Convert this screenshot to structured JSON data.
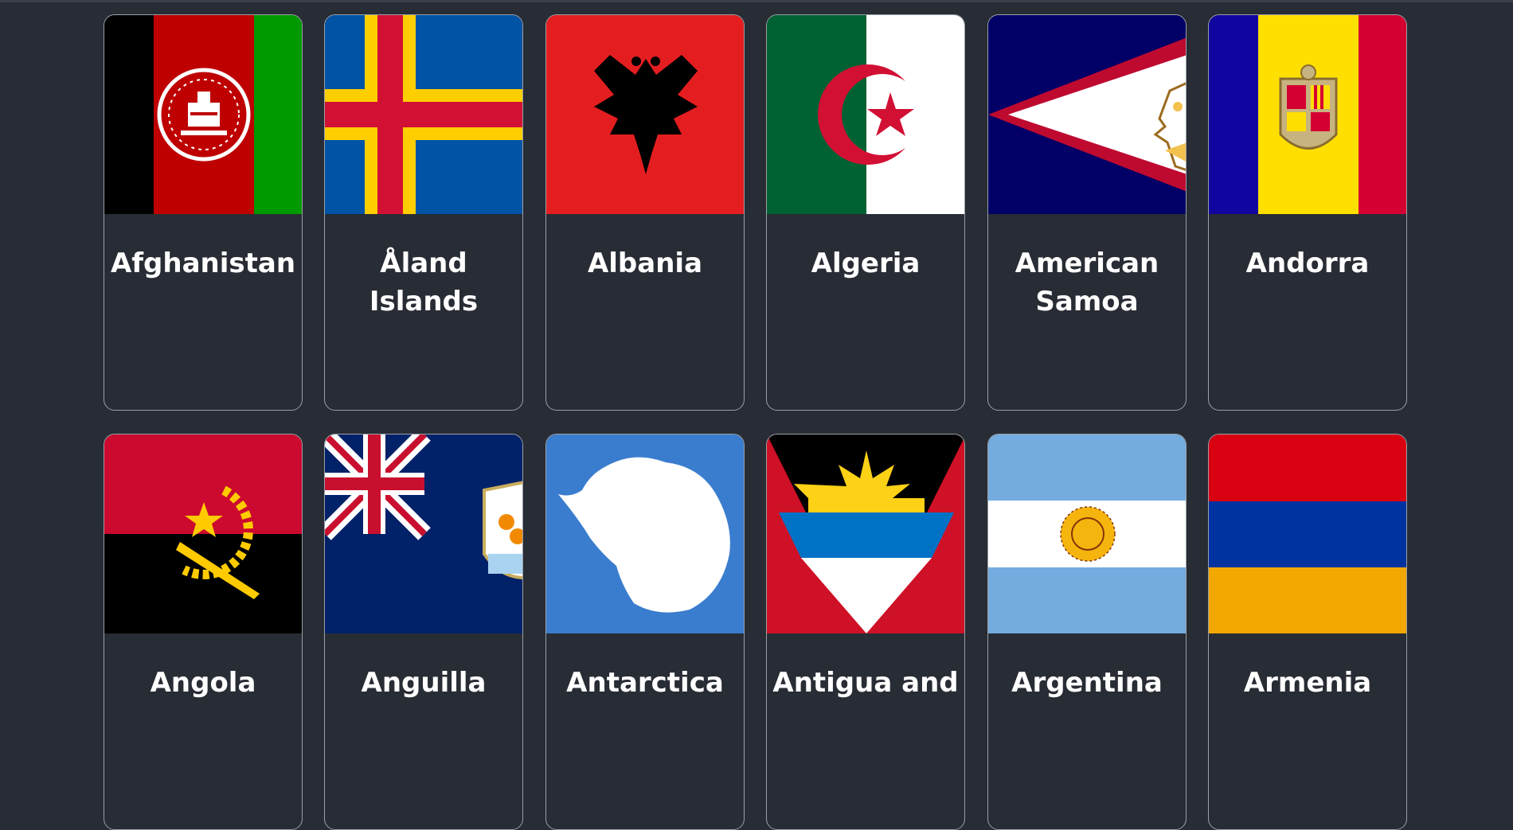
{
  "colors": {
    "background": "#282c34",
    "card_border": "#9aa0a8",
    "text": "#ffffff"
  },
  "countries": [
    {
      "name": "Afghanistan",
      "flag_icon": "afghanistan-flag-icon"
    },
    {
      "name": "Åland Islands",
      "flag_icon": "aland-islands-flag-icon"
    },
    {
      "name": "Albania",
      "flag_icon": "albania-flag-icon"
    },
    {
      "name": "Algeria",
      "flag_icon": "algeria-flag-icon"
    },
    {
      "name": "American Samoa",
      "flag_icon": "american-samoa-flag-icon"
    },
    {
      "name": "Andorra",
      "flag_icon": "andorra-flag-icon"
    },
    {
      "name": "Angola",
      "flag_icon": "angola-flag-icon"
    },
    {
      "name": "Anguilla",
      "flag_icon": "anguilla-flag-icon"
    },
    {
      "name": "Antarctica",
      "flag_icon": "antarctica-flag-icon"
    },
    {
      "name": "Antigua and",
      "flag_icon": "antigua-and-barbuda-flag-icon"
    },
    {
      "name": "Argentina",
      "flag_icon": "argentina-flag-icon"
    },
    {
      "name": "Armenia",
      "flag_icon": "armenia-flag-icon"
    }
  ]
}
